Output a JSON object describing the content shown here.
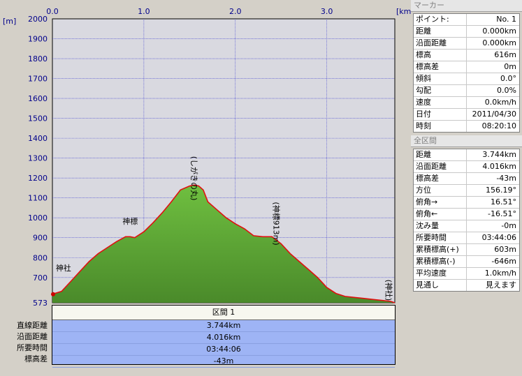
{
  "panel": {
    "marker_title": "マーカー",
    "marker_rows": [
      {
        "k": "ポイント:",
        "v": "No. 1"
      },
      {
        "k": "距離",
        "v": "0.000km"
      },
      {
        "k": "沿面距離",
        "v": "0.000km"
      },
      {
        "k": "標高",
        "v": "616m"
      },
      {
        "k": "標高差",
        "v": "0m"
      },
      {
        "k": "傾斜",
        "v": "0.0°"
      },
      {
        "k": "勾配",
        "v": "0.0%"
      },
      {
        "k": "速度",
        "v": "0.0km/h"
      },
      {
        "k": "日付",
        "v": "2011/04/30"
      },
      {
        "k": "時刻",
        "v": "08:20:10"
      }
    ],
    "all_title": "全区間",
    "all_rows": [
      {
        "k": "距離",
        "v": "3.744km"
      },
      {
        "k": "沿面距離",
        "v": "4.016km"
      },
      {
        "k": "標高差",
        "v": "-43m"
      },
      {
        "k": "方位",
        "v": "156.19°"
      },
      {
        "k": "俯角→",
        "v": "16.51°"
      },
      {
        "k": "俯角←",
        "v": "-16.51°"
      },
      {
        "k": "沈み量",
        "v": "-0m"
      },
      {
        "k": "所要時間",
        "v": "03:44:06"
      },
      {
        "k": "累積標高(+)",
        "v": "603m"
      },
      {
        "k": "累積標高(-)",
        "v": "-646m"
      },
      {
        "k": "平均速度",
        "v": "1.0km/h"
      },
      {
        "k": "見通し",
        "v": "見えます"
      }
    ]
  },
  "section": {
    "header": "区間 1",
    "labels": [
      "直線距離",
      "沿面距離",
      "所要時間",
      "標高差"
    ],
    "values": [
      "3.744km",
      "4.016km",
      "03:44:06",
      "-43m"
    ]
  },
  "chart_data": {
    "type": "area",
    "x_unit": "[km]",
    "y_unit": "[m]",
    "xlim": [
      0.0,
      3.744
    ],
    "ylim": [
      573,
      2000
    ],
    "x_ticks": [
      "0.0",
      "1.0",
      "2.0",
      "3.0"
    ],
    "y_ticks": [
      "2000",
      "1900",
      "1800",
      "1700",
      "1600",
      "1500",
      "1400",
      "1300",
      "1200",
      "1100",
      "1000",
      "900",
      "800",
      "700",
      "573"
    ],
    "fill_color": "#5fa83a",
    "line_color": "#e01010",
    "profile": {
      "x": [
        0.0,
        0.1,
        0.2,
        0.3,
        0.4,
        0.5,
        0.6,
        0.7,
        0.8,
        0.85,
        0.9,
        1.0,
        1.1,
        1.2,
        1.3,
        1.4,
        1.5,
        1.55,
        1.6,
        1.65,
        1.7,
        1.8,
        1.9,
        2.0,
        2.1,
        2.2,
        2.3,
        2.4,
        2.5,
        2.6,
        2.7,
        2.8,
        2.9,
        3.0,
        3.1,
        3.2,
        3.3,
        3.4,
        3.5,
        3.6,
        3.7,
        3.744
      ],
      "y": [
        616,
        630,
        680,
        730,
        780,
        820,
        850,
        880,
        905,
        905,
        900,
        930,
        975,
        1025,
        1080,
        1140,
        1160,
        1165,
        1160,
        1140,
        1080,
        1040,
        1000,
        970,
        945,
        910,
        905,
        905,
        870,
        820,
        780,
        740,
        700,
        650,
        620,
        605,
        600,
        595,
        590,
        585,
        580,
        573
      ]
    },
    "annotations": [
      {
        "text": "神社",
        "x": 0.12,
        "y": 735,
        "orient": "h"
      },
      {
        "text": "神標",
        "x": 0.85,
        "y": 970,
        "orient": "h"
      },
      {
        "text": "(しがきの丸)",
        "x": 1.55,
        "y": 1310,
        "orient": "v"
      },
      {
        "text": "(神標913m)",
        "x": 2.45,
        "y": 1080,
        "orient": "v"
      },
      {
        "text": "(神社)",
        "x": 3.68,
        "y": 690,
        "orient": "v"
      }
    ]
  }
}
